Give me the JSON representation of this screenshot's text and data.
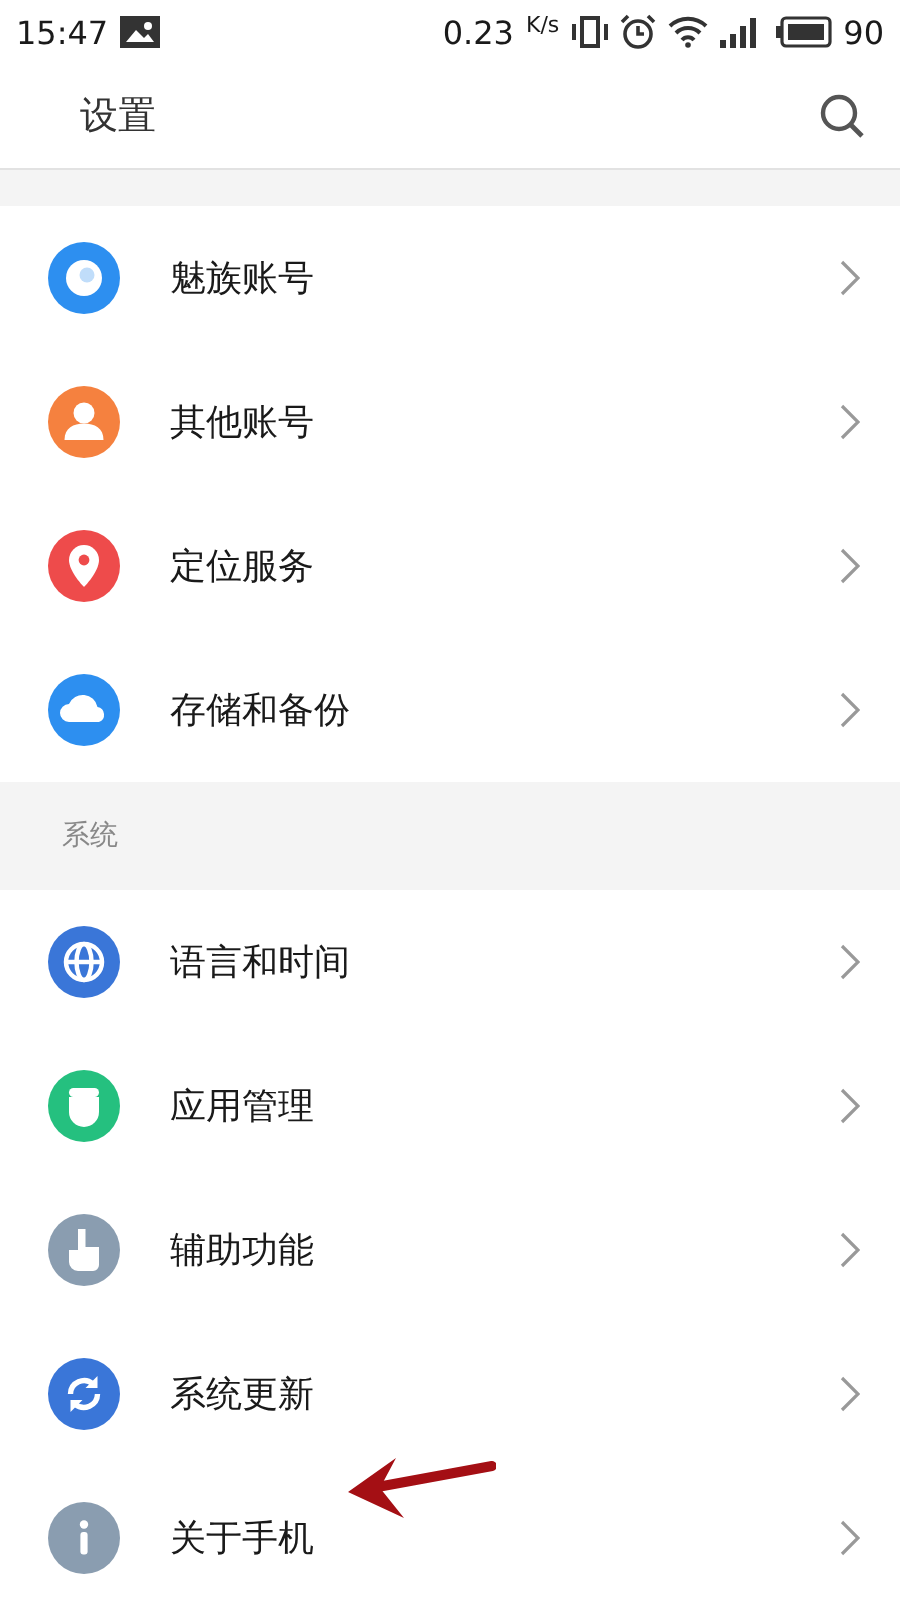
{
  "status_bar": {
    "time": "15:47",
    "speed": "0.23",
    "speed_unit": "K/s",
    "battery": "90"
  },
  "header": {
    "title": "设置"
  },
  "sections": [
    {
      "items": [
        {
          "label": "魅族账号",
          "kind": "account",
          "color": "#2d8ff0"
        },
        {
          "label": "其他账号",
          "kind": "person",
          "color": "#f5813f"
        },
        {
          "label": "定位服务",
          "kind": "location",
          "color": "#ee4b4b"
        },
        {
          "label": "存储和备份",
          "kind": "cloud",
          "color": "#2d8ff0"
        }
      ]
    },
    {
      "title": "系统",
      "items": [
        {
          "label": "语言和时间",
          "kind": "globe",
          "color": "#3a76d8"
        },
        {
          "label": "应用管理",
          "kind": "robot",
          "color": "#25c07f"
        },
        {
          "label": "辅助功能",
          "kind": "hand",
          "color": "#8a9db0"
        },
        {
          "label": "系统更新",
          "kind": "refresh",
          "color": "#3a76d8"
        },
        {
          "label": "关于手机",
          "kind": "info",
          "color": "#8a9db0"
        }
      ]
    }
  ]
}
